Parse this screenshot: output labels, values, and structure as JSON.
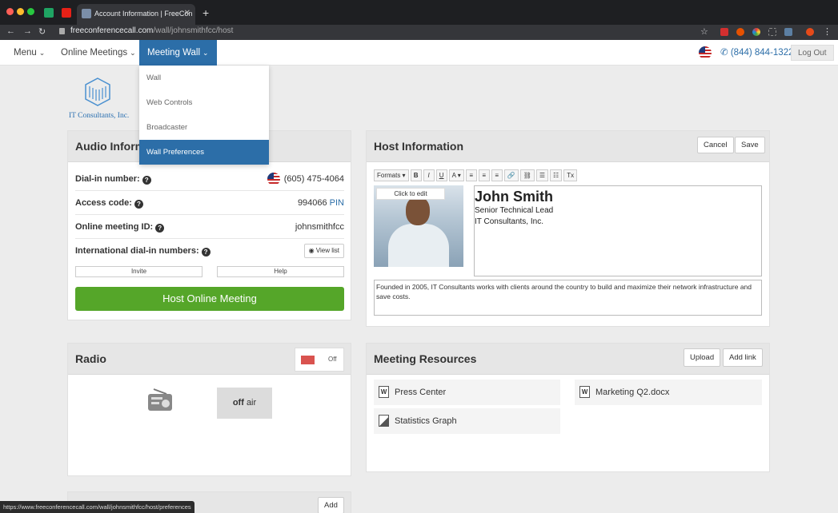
{
  "browser": {
    "tab_title": "Account Information | FreeCon",
    "tab_close": "✕",
    "new_tab": "+",
    "back": "←",
    "forward": "→",
    "reload": "↻",
    "url_domain": "freeconferencecall.com",
    "url_path": "/wall/johnsmithfcc/host",
    "star": "☆",
    "status_url": "https://www.freeconferencecall.com/wall/johnsmithfcc/host/preferences"
  },
  "nav": {
    "menu": "Menu",
    "online_meetings": "Online Meetings",
    "meeting_wall": "Meeting Wall",
    "chevron": "⌄",
    "phone": "(844) 844-1322",
    "phone_icon": "✆",
    "logout": "Log Out"
  },
  "dropdown": {
    "items": [
      "Wall",
      "Web Controls",
      "Broadcaster",
      "Wall Preferences"
    ]
  },
  "logo": {
    "text": "IT Consultants, Inc."
  },
  "audio": {
    "title": "Audio Inform",
    "dial_in_label": "Dial-in number:",
    "dial_in_value": "(605) 475-4064",
    "access_label": "Access code:",
    "access_value": "994066",
    "pin": "PIN",
    "meeting_id_label": "Online meeting ID:",
    "meeting_id_value": "johnsmithfcc",
    "intl_label": "International dial-in numbers:",
    "view_list": "View list",
    "invite": "Invite",
    "help": "Help",
    "host_button": "Host Online Meeting",
    "q": "?"
  },
  "host_info": {
    "title": "Host Information",
    "cancel": "Cancel",
    "save": "Save",
    "toolbar": [
      "Formats ▾",
      "B",
      "I",
      "U",
      "A ▾",
      "≡",
      "≡",
      "≡",
      "🔗",
      "⛓",
      "☰",
      "☷",
      "Tx"
    ],
    "click_to_edit": "Click to edit",
    "name": "John Smith",
    "role": "Senior Technical Lead",
    "company": "IT Consultants, Inc.",
    "about": "Founded in 2005, IT Consultants works with clients around the country to build and maximize their network infrastructure and save costs."
  },
  "radio": {
    "title": "Radio",
    "toggle_state": "Off",
    "off_word": "off",
    "air_word": "air"
  },
  "resources": {
    "title": "Meeting Resources",
    "upload": "Upload",
    "add_link": "Add link",
    "items": [
      "Press Center",
      "Marketing Q2.docx",
      "Statistics Graph"
    ]
  },
  "bottom_panel": {
    "add": "Add"
  },
  "colors": {
    "accent": "#2c6ea8",
    "green": "#55a629",
    "toggle_off": "#d9534f"
  }
}
